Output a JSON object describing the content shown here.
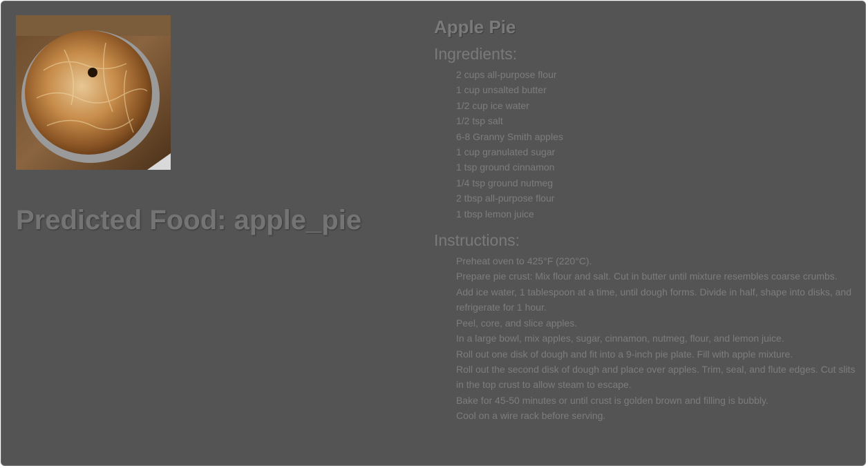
{
  "image": {
    "alt": "apple pie photo"
  },
  "prediction": {
    "text": "Predicted Food: apple_pie"
  },
  "recipe": {
    "title": "Apple Pie",
    "ingredients_heading": "Ingredients:",
    "ingredients": [
      "2 cups all-purpose flour",
      "1 cup unsalted butter",
      "1/2 cup ice water",
      "1/2 tsp salt",
      "6-8 Granny Smith apples",
      "1 cup granulated sugar",
      "1 tsp ground cinnamon",
      "1/4 tsp ground nutmeg",
      "2 tbsp all-purpose flour",
      "1 tbsp lemon juice"
    ],
    "instructions_heading": "Instructions:",
    "instructions": [
      "Preheat oven to 425°F (220°C).",
      "Prepare pie crust: Mix flour and salt. Cut in butter until mixture resembles coarse crumbs.",
      "Add ice water, 1 tablespoon at a time, until dough forms. Divide in half, shape into disks, and refrigerate for 1 hour.",
      "Peel, core, and slice apples.",
      "In a large bowl, mix apples, sugar, cinnamon, nutmeg, flour, and lemon juice.",
      "Roll out one disk of dough and fit into a 9-inch pie plate. Fill with apple mixture.",
      "Roll out the second disk of dough and place over apples. Trim, seal, and flute edges. Cut slits in the top crust to allow steam to escape.",
      "Bake for 45-50 minutes or until crust is golden brown and filling is bubbly.",
      "Cool on a wire rack before serving."
    ]
  },
  "colors": {
    "background": "#545454",
    "text_muted": "#7d7d7d",
    "heading": "#7a7a7a"
  }
}
